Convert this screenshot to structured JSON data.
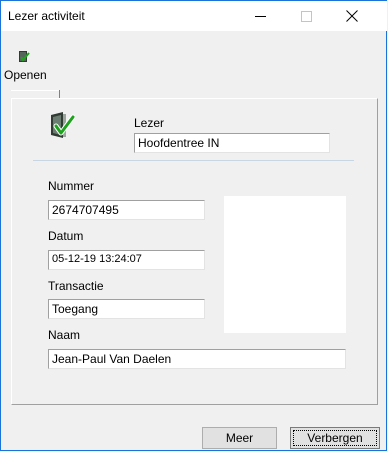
{
  "window": {
    "title": "Lezer activiteit",
    "minimize_glyph": "—",
    "maximize_glyph": "☐",
    "close_glyph": "✕"
  },
  "toolbar": {
    "open_label": "Openen",
    "open_icon": "door-check-icon"
  },
  "reader": {
    "icon": "door-check-icon",
    "label": "Lezer",
    "value": "Hoofdentree IN"
  },
  "fields": {
    "nummer_label": "Nummer",
    "nummer_value": "2674707495",
    "datum_label": "Datum",
    "datum_value": "05-12-19 13:24:07",
    "transactie_label": "Transactie",
    "transactie_value": "Toegang",
    "naam_label": "Naam",
    "naam_value": "Jean-Paul Van Daelen"
  },
  "buttons": {
    "meer": "Meer",
    "verbergen": "Verbergen"
  },
  "colors": {
    "window_border": "#1a73d9",
    "check_green": "#1fa31f",
    "door_dark": "#2f3b33"
  }
}
